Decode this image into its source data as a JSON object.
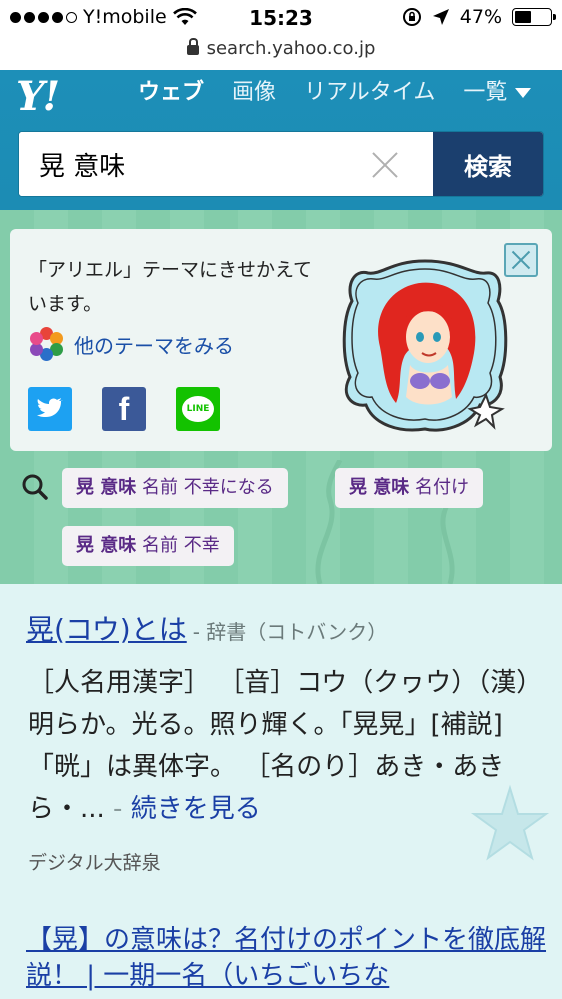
{
  "status_bar": {
    "carrier": "Y!mobile",
    "time": "15:23",
    "battery": "47%",
    "battery_level": 0.47,
    "url": "search.yahoo.co.jp"
  },
  "header": {
    "logo": "Y!",
    "tabs": [
      "ウェブ",
      "画像",
      "リアルタイム"
    ],
    "more_label": "一覧",
    "search_value": "晃 意味",
    "search_button": "検索"
  },
  "theme": {
    "message": "「アリエル」テーマにきせかえています。",
    "link_label": "他のテーマをみる",
    "line_label": "LINE",
    "facebook_label": "f"
  },
  "related": [
    {
      "bold": "晃 意味",
      "rest": " 名前 不幸になる"
    },
    {
      "bold": "晃 意味",
      "rest": " 名付け"
    },
    {
      "bold": "晃 意味",
      "rest": " 名前 不幸"
    }
  ],
  "results": {
    "r1": {
      "title": "晃(コウ)とは",
      "source": "- 辞書（コトバンク）",
      "body": "［人名用漢字］ ［音］コウ（クヮウ）（漢）明らか。光る。照り輝く。「晃晃」[補説]「晄」は異体字。 ［名のり］あき・あきら・...",
      "dash": " - ",
      "more": "続きを見る",
      "site": "デジタル大辞泉"
    },
    "r2": {
      "title": "【晃】の意味は？名付けのポイントを徹底解説！ | 一期一名（いちごいちな"
    }
  },
  "colors": {
    "header": "#1d8fb8",
    "search_button": "#1b3f6e",
    "link": "#1a3fa5",
    "chip_text": "#5a2a86",
    "theme_band": "#87cfad"
  }
}
